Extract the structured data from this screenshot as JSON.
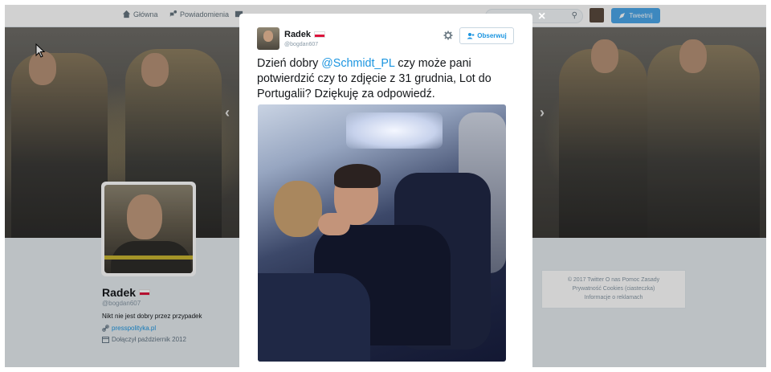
{
  "nav": {
    "home_label": "Główna",
    "notifications_label": "Powiadomienia",
    "tweet_button_label": "Tweetnij"
  },
  "profile": {
    "name": "Radek",
    "handle": "@bogdan607",
    "bio": "Nikt nie jest dobry przez przypadek",
    "link": "presspolityka.pl",
    "joined": "Dołączył październik 2012"
  },
  "footer": {
    "line1": "© 2017 Twitter   O nas   Pomoc   Zasady",
    "line2": "Prywatność   Cookies (ciasteczka)",
    "line3": "Informacje o reklamach"
  },
  "modal": {
    "close_label": "×",
    "author_name": "Radek",
    "author_handle": "@bogdan607",
    "follow_label": "Obserwuj",
    "tweet_text_before": "Dzień dobry ",
    "tweet_mention": "@Schmidt_PL",
    "tweet_text_after": " czy może pani potwierdzić czy to zdjęcie z 31 grudnia, Lot do Portugalii? Dziękuję za odpowiedź."
  },
  "colors": {
    "accent": "#1b95e0",
    "tweet_button": "#4ba6e9"
  },
  "icons": [
    "home-icon",
    "notifications-icon",
    "messages-icon",
    "search-icon",
    "gear-icon",
    "follow-icon",
    "link-icon",
    "calendar-icon",
    "close-icon"
  ]
}
